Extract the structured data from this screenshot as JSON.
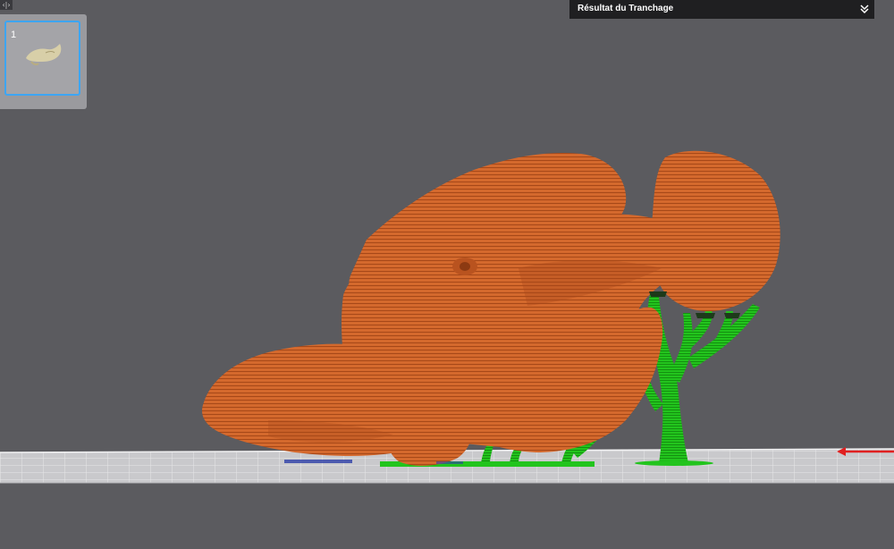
{
  "header": {
    "panel_toggle_glyph": "‹|›",
    "slice_result_title": "Résultat du Tranchage"
  },
  "plates": {
    "items": [
      {
        "number": "1",
        "selected": true,
        "thumbnail": "fish-model"
      }
    ]
  },
  "scene": {
    "model_color": "#d2692f",
    "support_color": "#22c11d",
    "bed_color": "#cfcfd2",
    "background_color": "#5b5b5f",
    "axis_x_color": "#e02020"
  },
  "accent_color": "#3da5f4"
}
